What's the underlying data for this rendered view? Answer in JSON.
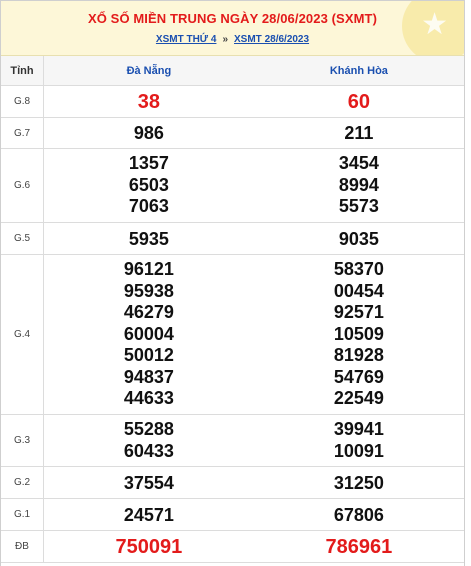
{
  "header": {
    "title": "XỔ SỐ MIỀN TRUNG NGÀY 28/06/2023 (SXMT)",
    "link1": "XSMT THỨ 4",
    "separator": "»",
    "link2": "XSMT 28/6/2023"
  },
  "table": {
    "col_label": "Tỉnh",
    "provinces": [
      "Đà Nẵng",
      "Khánh Hòa"
    ],
    "rows": [
      {
        "label": "G.8",
        "a": [
          "38"
        ],
        "b": [
          "60"
        ]
      },
      {
        "label": "G.7",
        "a": [
          "986"
        ],
        "b": [
          "211"
        ]
      },
      {
        "label": "G.6",
        "a": [
          "1357",
          "6503",
          "7063"
        ],
        "b": [
          "3454",
          "8994",
          "5573"
        ]
      },
      {
        "label": "G.5",
        "a": [
          "5935"
        ],
        "b": [
          "9035"
        ]
      },
      {
        "label": "G.4",
        "a": [
          "96121",
          "95938",
          "46279",
          "60004",
          "50012",
          "94837",
          "44633"
        ],
        "b": [
          "58370",
          "00454",
          "92571",
          "10509",
          "81928",
          "54769",
          "22549"
        ]
      },
      {
        "label": "G.3",
        "a": [
          "55288",
          "60433"
        ],
        "b": [
          "39941",
          "10091"
        ]
      },
      {
        "label": "G.2",
        "a": [
          "37554"
        ],
        "b": [
          "31250"
        ]
      },
      {
        "label": "G.1",
        "a": [
          "24571"
        ],
        "b": [
          "67806"
        ]
      },
      {
        "label": "ĐB",
        "a": [
          "750091"
        ],
        "b": [
          "786961"
        ]
      }
    ]
  },
  "colors": {
    "accent_red": "#e31b1b",
    "link_blue": "#1a4fb0",
    "header_bg": "#fdf7d8"
  }
}
